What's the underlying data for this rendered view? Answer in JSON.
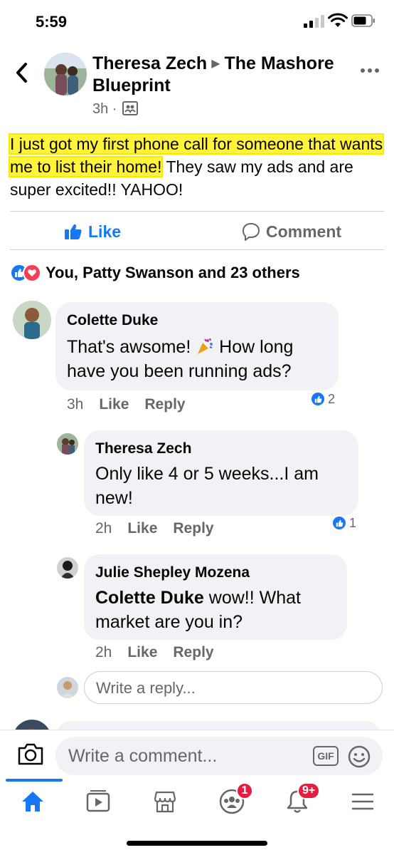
{
  "status_bar": {
    "time": "5:59"
  },
  "post": {
    "author": "Theresa Zech",
    "group": "The Mashore Blueprint",
    "time": "3h ·",
    "text_highlighted": "I just got my first phone call for someone that wants me to list their home!",
    "text_rest": " They saw my ads and are super excited!! YAHOO!"
  },
  "actions": {
    "like": "Like",
    "comment": "Comment"
  },
  "reactions": {
    "summary": "You, Patty Swanson and 23 others"
  },
  "comments": [
    {
      "name": "Colette Duke",
      "text_a": "That's awsome! ",
      "text_b": " How long have you been running ads?",
      "time": "3h",
      "like": "Like",
      "reply": "Reply",
      "likes": "2"
    },
    {
      "name": "Theresa Zech",
      "text": "Only like 4 or 5 weeks...I am new!",
      "time": "2h",
      "like": "Like",
      "reply": "Reply",
      "likes": "1"
    },
    {
      "name": "Julie Shepley Mozena",
      "mention": "Colette Duke",
      "text": " wow!!  What market are you in?",
      "time": "2h",
      "like": "Like",
      "reply": "Reply"
    }
  ],
  "reply_input": {
    "placeholder": "Write a reply..."
  },
  "composer": {
    "placeholder": "Write a comment...",
    "gif": "GIF"
  },
  "tabs": {
    "groups_badge": "1",
    "notifications_badge": "9+"
  },
  "colors": {
    "accent": "#1877f2",
    "highlight": "#fff43a",
    "badge": "#e41e3f"
  }
}
